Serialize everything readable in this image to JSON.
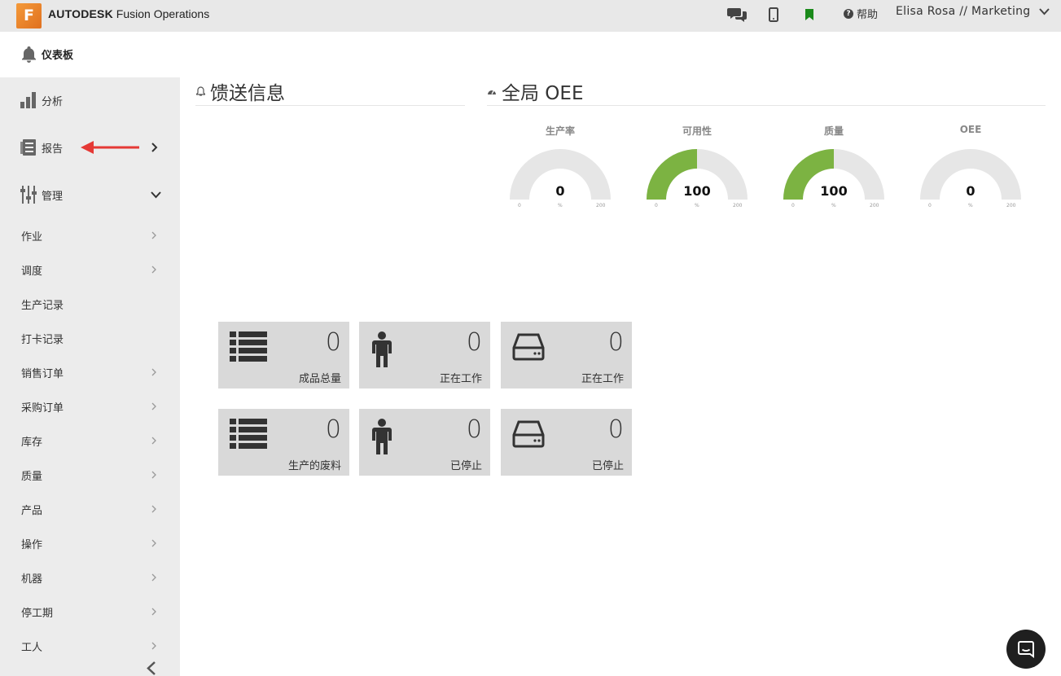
{
  "header": {
    "logo_letter": "F",
    "brand_bold": "AUTODESK",
    "brand_product": " Fusion Operations",
    "help_label": "帮助",
    "user_label": "Elisa Rosa // Marketing",
    "bookmark_color": "#1a8a1a"
  },
  "sidebar": {
    "dashboard_label": "仪表板",
    "analysis_label": "分析",
    "reports_label": "报告",
    "manage_label": "管理",
    "sub_items": [
      "作业",
      "调度",
      "生产记录",
      "打卡记录",
      "销售订单",
      "采购订单",
      "库存",
      "质量",
      "产品",
      "操作",
      "机器",
      "停工期",
      "工人"
    ]
  },
  "feed": {
    "title": "馈送信息"
  },
  "oee": {
    "title": "全局 OEE",
    "accent": "#7cb342",
    "gauges": [
      {
        "label": "生产率",
        "value": "0",
        "min": "0",
        "max": "200",
        "unit": "%",
        "fraction": 0
      },
      {
        "label": "可用性",
        "value": "100",
        "min": "0",
        "max": "200",
        "unit": "%",
        "fraction": 0.5
      },
      {
        "label": "质量",
        "value": "100",
        "min": "0",
        "max": "200",
        "unit": "%",
        "fraction": 0.5
      },
      {
        "label": "OEE",
        "value": "0",
        "min": "0",
        "max": "200",
        "unit": "%",
        "fraction": 0
      }
    ]
  },
  "tiles": [
    {
      "icon": "list-icon",
      "value": "0",
      "label": "成品总量"
    },
    {
      "icon": "person-icon",
      "value": "0",
      "label": "正在工作"
    },
    {
      "icon": "drive-icon",
      "value": "0",
      "label": "正在工作"
    },
    {
      "icon": "list-icon",
      "value": "0",
      "label": "生产的废料"
    },
    {
      "icon": "person-icon",
      "value": "0",
      "label": "已停止"
    },
    {
      "icon": "drive-icon",
      "value": "0",
      "label": "已停止"
    }
  ]
}
